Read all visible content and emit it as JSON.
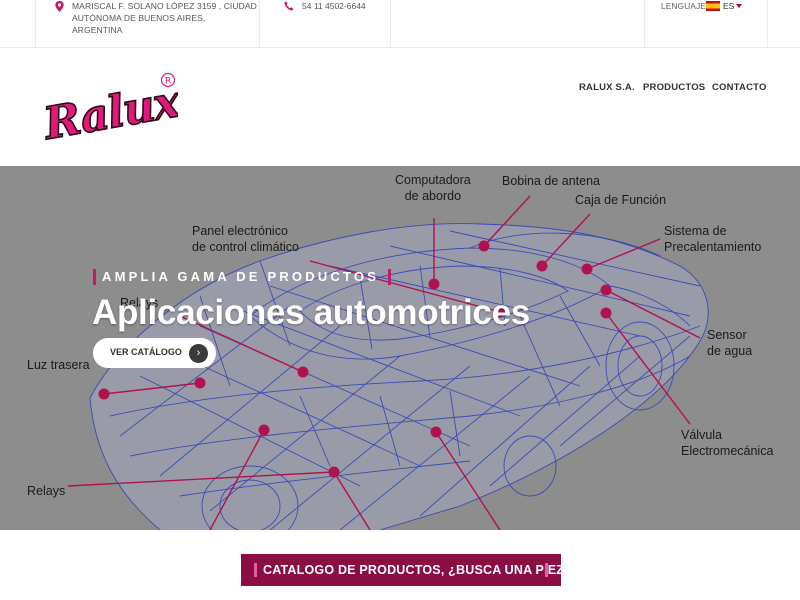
{
  "topbar": {
    "address": "MARISCAL F. SOLANO LÓPEZ 3159 , CIUDAD AUTÓNOMA DE BUENOS AIRES, ARGENTINA",
    "address_icon": "map-pin-icon",
    "phone": "54 11 4502-6644",
    "phone_icon": "phone-icon",
    "language_label": "LENGUAJE",
    "language_code": "ES",
    "language_flag": "spain-flag-icon"
  },
  "header": {
    "logo_text": "Ralux",
    "logo_mark": "®",
    "nav": [
      "RALUX S.A.",
      "PRODUCTOS",
      "CONTACTO"
    ]
  },
  "hero": {
    "tagline": "AMPLIA GAMA DE PRODUCTOS",
    "headline": "Aplicaciones automotrices",
    "cta_label": "VER CATÁLOGO",
    "cta_icon": "chevron-right-icon",
    "diagram_labels": {
      "computadora": "Computadora\nde abordo",
      "bobina": "Bobina de antena",
      "caja": "Caja de Función",
      "panel": "Panel electrónico\nde control climático",
      "sistema": "Sistema de\nPrecalentamiento",
      "relays_top": "Relays",
      "sensor": "Sensor\nde agua",
      "luz": "Luz trasera",
      "valvula": "Válvula\nElectromecánica",
      "relays_bottom": "Relays"
    }
  },
  "catalog": {
    "button_label": "CATALOGO DE PRODUCTOS, ¿BUSCA UNA PIEZA?"
  },
  "colors": {
    "accent": "#8a0d43",
    "brand_pink": "#e0197a",
    "marker": "#b0124f",
    "wireframe": "#2a3fb5",
    "hero_bg": "#8d8d8d"
  }
}
